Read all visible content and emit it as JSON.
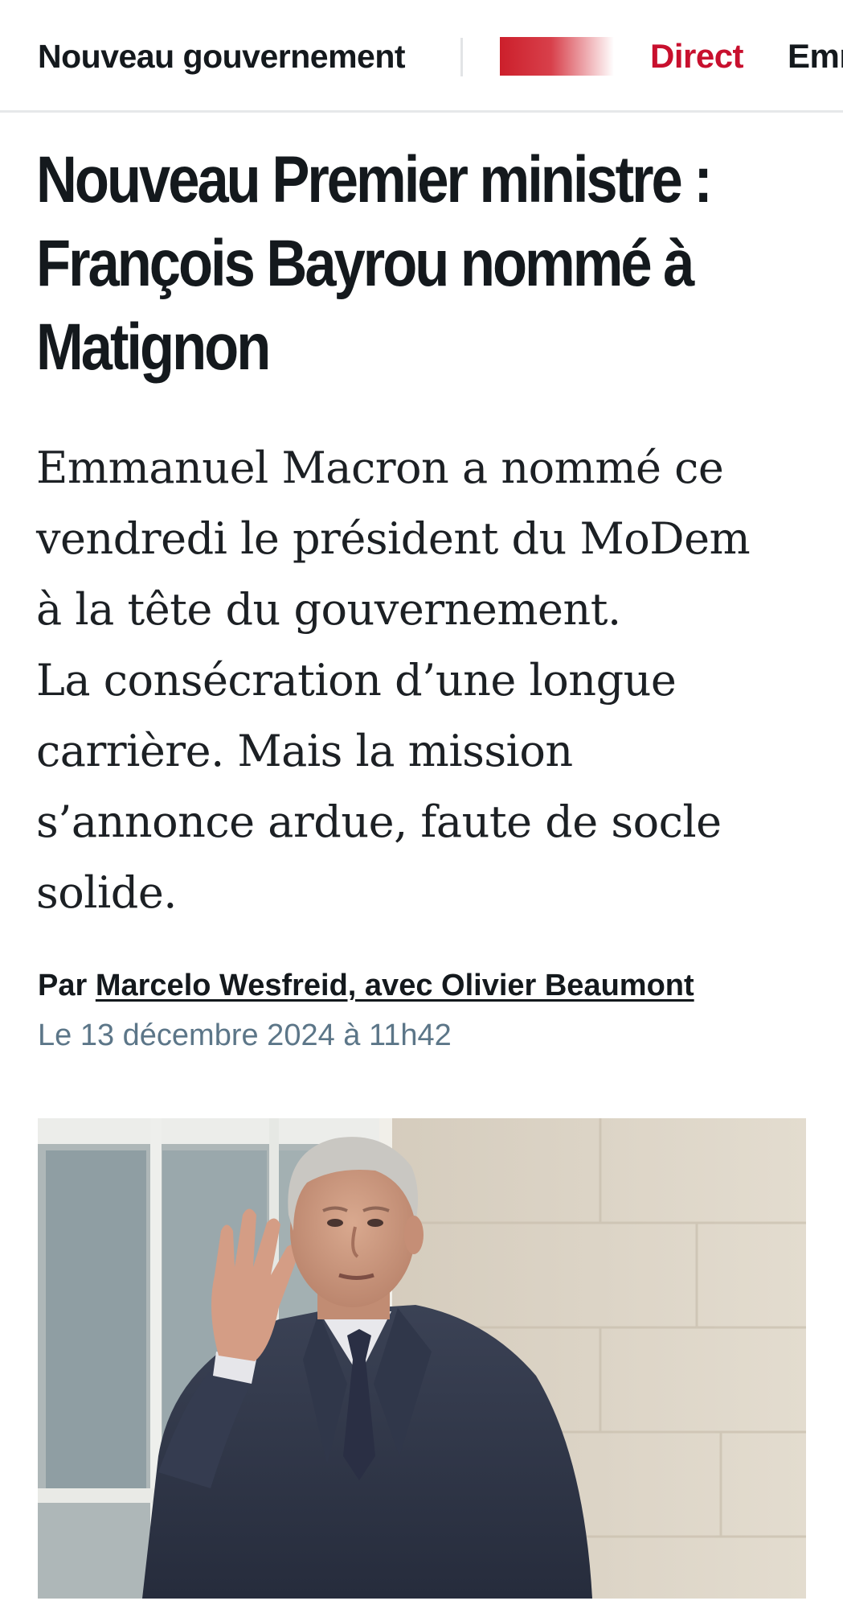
{
  "nav": {
    "section_label": "Nouveau gouvernement",
    "live_label": "Direct",
    "next_label": "Emm"
  },
  "article": {
    "headline_lines": [
      "Nouveau Premier ministre :",
      "François Bayrou nommé à",
      "Matignon"
    ],
    "lead_lines": [
      "Emmanuel Macron a nommé ce",
      "vendredi le président du MoDem",
      "à la tête du gouvernement.",
      "La consécration d’une longue",
      "carrière. Mais la mission",
      "s’annonce ardue, faute de socle",
      "solide."
    ],
    "byline_prefix": "Par",
    "byline_authors": "Marcelo Wesfreid, avec Olivier Beaumont",
    "date": "Le 13 décembre 2024 à 11h42"
  },
  "colors": {
    "text": "#14191d",
    "accent_red": "#c8102e",
    "date_gray": "#5c7688",
    "divider": "#e6e8ea"
  },
  "icons": {
    "live_indicator": "live-bar-icon"
  }
}
